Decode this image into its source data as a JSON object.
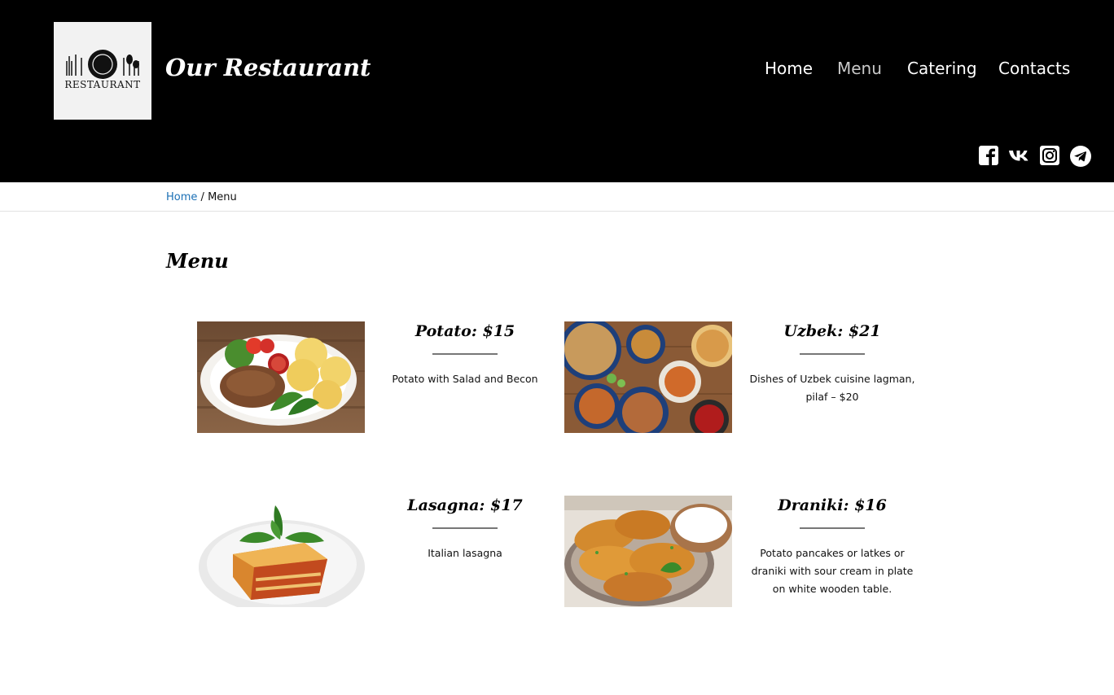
{
  "header": {
    "logo_text": "RESTAURANT",
    "site_title": "Our Restaurant",
    "nav": [
      {
        "label": "Home",
        "active": false
      },
      {
        "label": "Menu",
        "active": true
      },
      {
        "label": "Catering",
        "active": false
      },
      {
        "label": "Contacts",
        "active": false
      }
    ],
    "social_icons": [
      "facebook-icon",
      "vk-icon",
      "instagram-icon",
      "telegram-icon"
    ]
  },
  "breadcrumb": {
    "home_label": "Home",
    "separator": "/",
    "current": "Menu"
  },
  "page": {
    "title": "Menu"
  },
  "menu_items": [
    {
      "name": "Potato: $15",
      "description": "Potato with Salad and Becon",
      "image": "potato-dish-photo"
    },
    {
      "name": "Uzbek: $21",
      "description": "Dishes of Uzbek cuisine lagman, pilaf – $20",
      "image": "uzbek-dishes-photo"
    },
    {
      "name": "Lasagna: $17",
      "description": "Italian lasagna",
      "image": "lasagna-photo"
    },
    {
      "name": "Draniki: $16",
      "description": "Potato pancakes or latkes or draniki with sour cream in plate on white wooden table.",
      "image": "draniki-photo"
    }
  ],
  "colors": {
    "header_bg": "#000000",
    "link": "#1a6fb5",
    "nav_active": "#c9c9c9"
  }
}
